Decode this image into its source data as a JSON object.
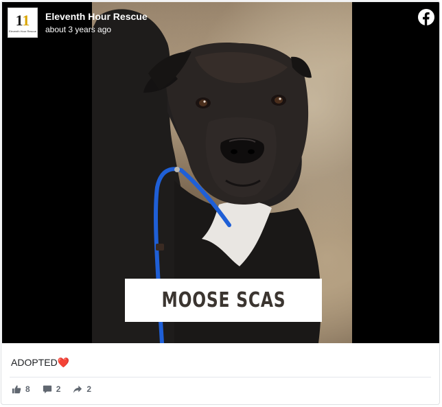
{
  "post": {
    "page_name": "Eleventh Hour Rescue",
    "timestamp": "about 3 years ago",
    "logo": {
      "mark_left": "1",
      "mark_right": "1",
      "tagline": "Eleventh Hour Rescue"
    },
    "image_caption": "MOOSE SCAS",
    "text": "ADOPTED",
    "emoji": "❤️"
  },
  "actions": [
    {
      "icon": "like-icon",
      "count": "8"
    },
    {
      "icon": "comment-icon",
      "count": "2"
    },
    {
      "icon": "share-icon",
      "count": "2"
    }
  ],
  "colors": {
    "facebook_icon": "#ffffff",
    "action_gray": "#606770",
    "heart": "#e0245e",
    "leash_blue": "#1f5fd6"
  },
  "icons": {
    "brand": "facebook-icon"
  }
}
